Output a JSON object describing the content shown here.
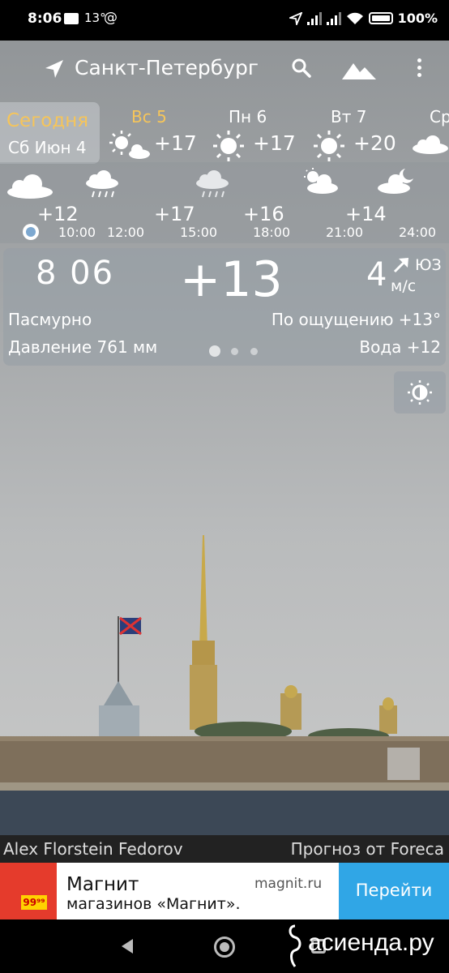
{
  "status_bar": {
    "time": "8:06",
    "temp": "13°",
    "at": "@",
    "battery": "100%"
  },
  "header": {
    "city": "Санкт-Петербург"
  },
  "daily": {
    "today_title": "Сегодня",
    "today_date": "Сб Июн 4",
    "days": [
      {
        "name": "Вс 5",
        "temp": "+17",
        "name_color": "#f6c55a",
        "icon": "sun-cloud-icon"
      },
      {
        "name": "Пн 6",
        "temp": "+17",
        "icon": "sun-icon"
      },
      {
        "name": "Вт 7",
        "temp": "+20",
        "icon": "sun-icon"
      },
      {
        "name": "Ср",
        "temp": "",
        "icon": "cloud-icon"
      }
    ]
  },
  "hourly": {
    "items": [
      {
        "temp": "+12",
        "time": "",
        "icon": "cloud-icon"
      },
      {
        "temp": "",
        "time": "10:00",
        "icon": "rain-icon"
      },
      {
        "temp": "",
        "time": "12:00",
        "icon": ""
      },
      {
        "temp": "+17",
        "time": "15:00",
        "icon": "rain-icon"
      },
      {
        "temp": "+16",
        "time": "18:00",
        "icon": ""
      },
      {
        "temp": "",
        "time": "21:00",
        "icon": "sun-cloud-icon"
      },
      {
        "temp": "+14",
        "time": "",
        "icon": ""
      },
      {
        "temp": "",
        "time": "24:00",
        "icon": "moon-cloud-icon"
      }
    ]
  },
  "current": {
    "time": "8 06",
    "temp": "+13",
    "wind_speed": "4",
    "wind_dir": "ЮЗ",
    "wind_unit": "м/с",
    "condition": "Пасмурно",
    "feels_like": "По ощущению +13°",
    "pressure": "Давление 761 мм",
    "water": "Вода +12",
    "page_index": 1,
    "page_count": 3
  },
  "credits": {
    "photo_author": "Alex Florstein Fedorov",
    "forecast_source": "Прогноз от Foreca"
  },
  "ad": {
    "title": "Магнит",
    "subtitle": "магазинов «Магнит».",
    "domain": "magnit.ru",
    "button": "Перейти",
    "price": "99⁹⁹"
  },
  "watermark": "асиенда.ру",
  "colors": {
    "today_accent": "#f6c55a",
    "ad_button": "#30a6e6",
    "ad_brand": "#e53b2c"
  }
}
